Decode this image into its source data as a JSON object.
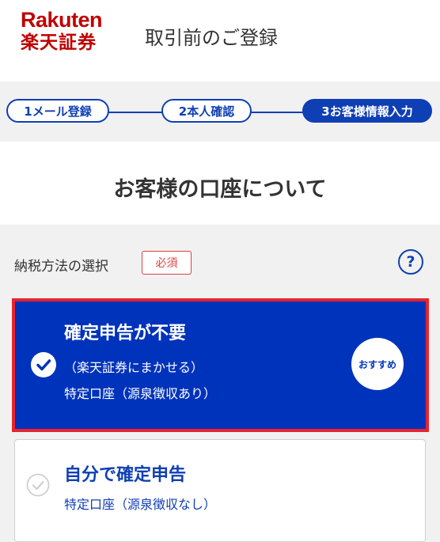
{
  "header": {
    "logo_text": "Rakuten",
    "logo_subtext": "楽天証券",
    "title": "取引前のご登録"
  },
  "stepper": {
    "steps": [
      {
        "label": "1メール登録",
        "status": "done"
      },
      {
        "label": "2本人確認",
        "status": "done"
      },
      {
        "label": "3お客様情報入力",
        "status": "current"
      }
    ]
  },
  "main": {
    "title": "お客様の口座について"
  },
  "tax_section": {
    "label": "納税方法の選択",
    "required_badge": "必須",
    "help_icon": "question-circle-icon",
    "options": [
      {
        "title": "確定申告が不要",
        "subtitle": "（楽天証券にまかせる）",
        "detail": "特定口座（源泉徴収あり）",
        "badge": "おすすめ",
        "selected": true
      },
      {
        "title": "自分で確定申告",
        "detail": "特定口座（源泉徴収なし）",
        "selected": false
      }
    ]
  },
  "colors": {
    "brand_red": "#bf0000",
    "primary_blue": "#0033bb",
    "highlight_red": "#e8232e",
    "required_red": "#e04040"
  }
}
